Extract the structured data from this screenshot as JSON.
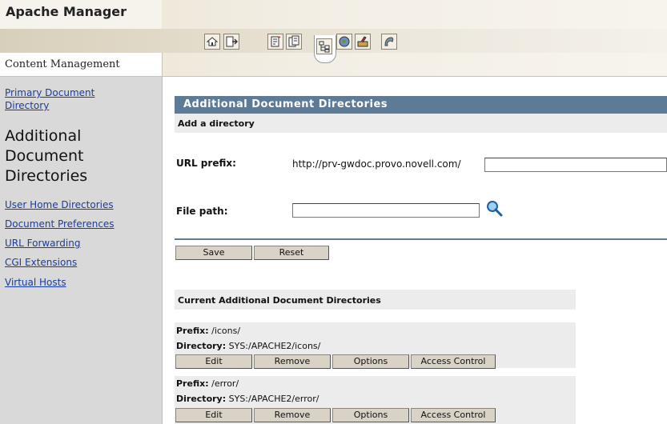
{
  "app": {
    "title": "Apache Manager",
    "section": "Content Management"
  },
  "toolbar": {
    "icons": [
      "home-icon",
      "exit-icon",
      "document-icon",
      "documents-icon",
      "tree-icon",
      "globe-icon",
      "tools-icon",
      "logo-icon"
    ],
    "active": "tree-icon"
  },
  "sidebar": {
    "primary_line1": "Primary Document",
    "primary_line2": "Directory",
    "current_line1": "Additional",
    "current_line2": "Document",
    "current_line3": "Directories",
    "items": [
      {
        "label": "User Home Directories"
      },
      {
        "label": "Document Preferences"
      },
      {
        "label": "URL Forwarding"
      },
      {
        "label": "CGI Extensions"
      },
      {
        "label": "Virtual Hosts"
      }
    ]
  },
  "main": {
    "title": "Additional Document Directories",
    "subhead": "Add a directory",
    "url_prefix_label": "URL prefix:",
    "url_prefix_base": "http://prv-gwdoc.provo.novell.com/",
    "url_prefix_value": "",
    "file_path_label": "File path:",
    "file_path_value": "",
    "save_label": "Save",
    "reset_label": "Reset",
    "list_title": "Current Additional Document Directories",
    "prefix_label": "Prefix:",
    "directory_label": "Directory:",
    "entries": [
      {
        "prefix": "/icons/",
        "directory": "SYS:/APACHE2/icons/"
      },
      {
        "prefix": "/error/",
        "directory": "SYS:/APACHE2/error/"
      }
    ],
    "actions": {
      "edit": "Edit",
      "remove": "Remove",
      "options": "Options",
      "access": "Access Control"
    }
  }
}
